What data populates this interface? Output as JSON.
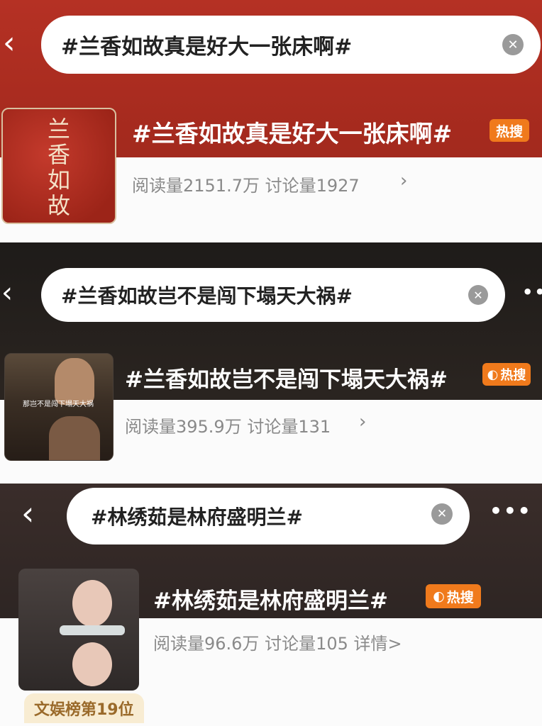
{
  "cards": [
    {
      "search_query": "#兰香如故真是好大一张床啊#",
      "title": "#兰香如故真是好大一张床啊#",
      "badge": "热搜",
      "stats": "阅读量2151.7万  讨论量1927",
      "thumb_text": [
        "兰",
        "香",
        "如",
        "故"
      ]
    },
    {
      "search_query": "#兰香如故岂不是闯下塌天大祸#",
      "title": "#兰香如故岂不是闯下塌天大祸#",
      "badge": "热搜",
      "stats": "阅读量395.9万  讨论量131",
      "thumb_subtitle": "那岂不是闯下塌天大祸"
    },
    {
      "search_query": "#林绣茹是林府盛明兰#",
      "title": "#林绣茹是林府盛明兰#",
      "badge": "热搜",
      "stats": "阅读量96.6万  讨论量105  详情>",
      "rank": "文娱榜第19位"
    }
  ],
  "icons": {
    "back": "chevron-left-icon",
    "clear": "close-circle-icon",
    "more": "more-horizontal-icon",
    "arrow": "chevron-right-icon"
  },
  "colors": {
    "panel1_bg": "#a52a1e",
    "badge": "#f07a1c",
    "stats_text": "#8a8a8a"
  }
}
